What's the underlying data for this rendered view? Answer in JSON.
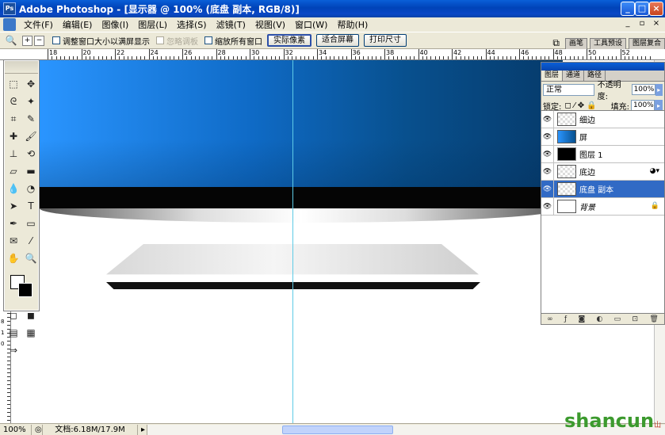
{
  "window": {
    "title": "Adobe Photoshop - [显示器 @ 100% (底盘 副本, RGB/8)]",
    "minimize_label": "_",
    "maximize_label": "□",
    "close_label": "×"
  },
  "menu": {
    "items": [
      "文件(F)",
      "编辑(E)",
      "图像(I)",
      "图层(L)",
      "选择(S)",
      "滤镜(T)",
      "视图(V)",
      "窗口(W)",
      "帮助(H)"
    ],
    "doc_controls": [
      "_",
      "▫",
      "×"
    ]
  },
  "options": {
    "resize_windows_label": "调整窗口大小以满屏显示",
    "ignore_palettes_label": "忽略调板",
    "zoom_all_label": "缩放所有窗口",
    "actual_pixels": "实际像素",
    "fit_screen": "适合屏幕",
    "print_size": "打印尺寸",
    "palette_well_tabs": [
      "画笔",
      "工具预设",
      "图层复合"
    ]
  },
  "rulers": {
    "h_labels": [
      "18",
      "20",
      "22",
      "24",
      "26",
      "28",
      "30",
      "32",
      "34",
      "36",
      "38",
      "40",
      "42",
      "44",
      "46",
      "48",
      "50",
      "52"
    ],
    "v_labels": [
      "8",
      "1",
      "0"
    ]
  },
  "layers_panel": {
    "tabs": [
      "图层",
      "通道",
      "路径"
    ],
    "blend_mode": "正常",
    "opacity_label": "不透明度:",
    "opacity_value": "100%",
    "lock_label": "锁定:",
    "fill_label": "填充:",
    "fill_value": "100%",
    "layers": [
      {
        "name": "细边",
        "selected": false
      },
      {
        "name": "屏",
        "selected": false
      },
      {
        "name": "图层 1",
        "selected": false
      },
      {
        "name": "底边",
        "selected": false
      },
      {
        "name": "底盘 副本",
        "selected": true
      },
      {
        "name": "背景",
        "selected": false
      }
    ]
  },
  "status": {
    "zoom": "100%",
    "doc_info": "文档:6.18M/17.9M"
  },
  "watermark": {
    "text": "shancun",
    "sub": "山村网"
  },
  "colors": {
    "accent": "#316ac5",
    "guide": "#5ecbe6"
  }
}
